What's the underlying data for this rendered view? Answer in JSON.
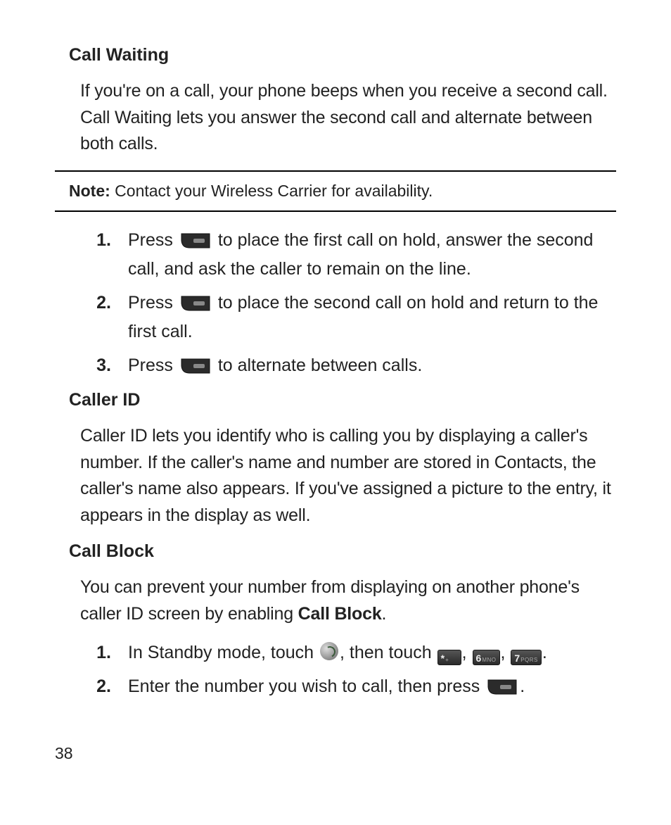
{
  "sections": {
    "callWaiting": {
      "heading": "Call Waiting",
      "para": "If you're on a call, your phone beeps when you receive a second call. Call Waiting lets you answer the second call and alternate between both calls.",
      "noteLabel": "Note:",
      "noteText": " Contact your Wireless Carrier for availability.",
      "steps": [
        {
          "num": "1.",
          "pre": "Press ",
          "post": " to place the first call on hold, answer the second call, and ask the caller to remain on the line."
        },
        {
          "num": "2.",
          "pre": "Press ",
          "post": " to place the second call on hold and return to the first call."
        },
        {
          "num": "3.",
          "pre": "Press ",
          "post": " to alternate between calls."
        }
      ]
    },
    "callerId": {
      "heading": "Caller ID",
      "para": "Caller ID lets you identify who is calling you by displaying a caller's number. If the caller's name and number are stored in Contacts, the caller's name also appears. If you've assigned a picture to the entry, it appears in the display as well."
    },
    "callBlock": {
      "heading": "Call Block",
      "para_pre": "You can prevent your number from displaying on another phone's caller ID screen by enabling ",
      "para_bold": "Call Block",
      "para_post": ".",
      "steps": [
        {
          "num": "1.",
          "t1": "In Standby mode, touch ",
          "t2": ", then touch ",
          "t3": ", ",
          "t4": ", ",
          "t5": "."
        },
        {
          "num": "2.",
          "t1": "Enter the number you wish to call, then press ",
          "t2": "."
        }
      ],
      "keys": {
        "star": {
          "main": "*",
          "sub": "+"
        },
        "six": {
          "main": "6",
          "sub": "MNO"
        },
        "seven": {
          "main": "7",
          "sub": "PQRS"
        }
      }
    }
  },
  "pageNumber": "38"
}
